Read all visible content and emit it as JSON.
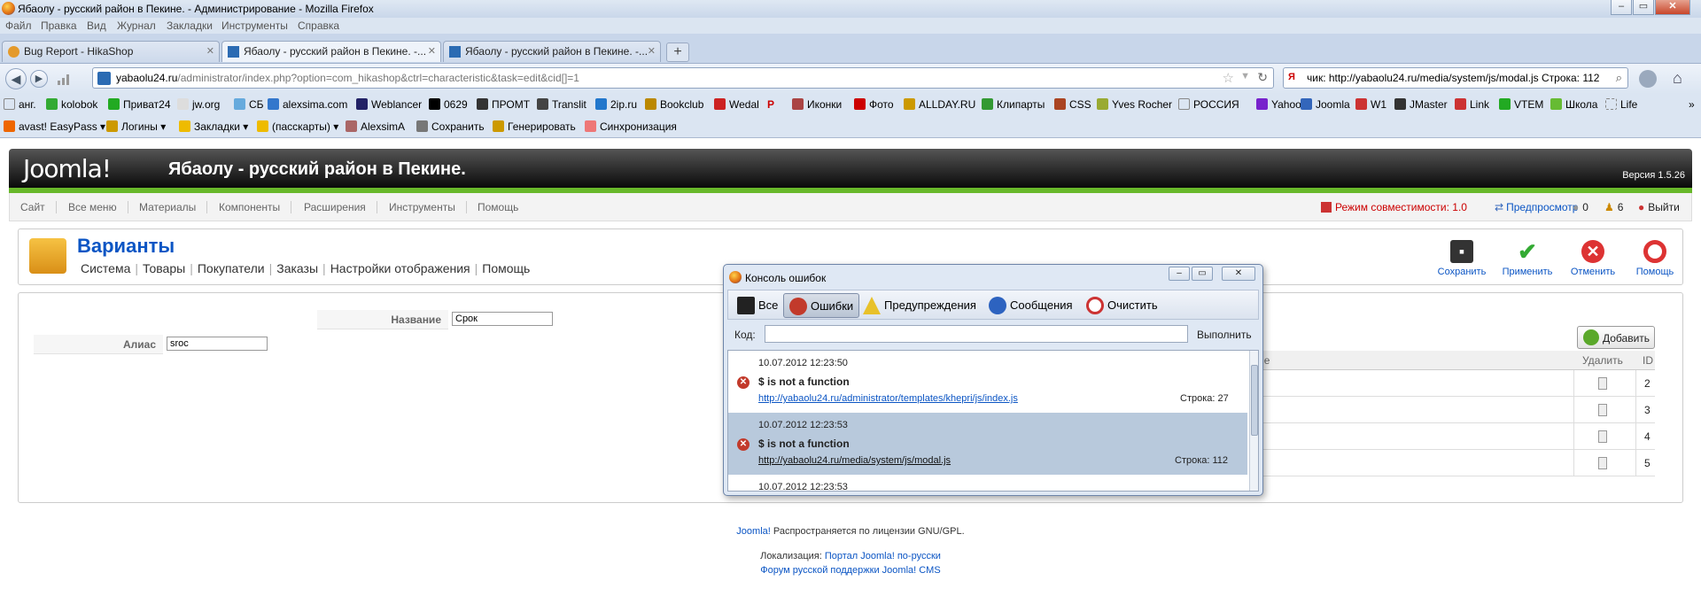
{
  "window": {
    "title": "Ябаолу - русский район в Пекине. - Администрирование - Mozilla Firefox"
  },
  "menu": [
    "Файл",
    "Правка",
    "Вид",
    "Журнал",
    "Закладки",
    "Инструменты",
    "Справка"
  ],
  "tabs": [
    {
      "label": "Bug Report - HikaShop"
    },
    {
      "label": "Ябаолу - русский район в Пекине. -..."
    },
    {
      "label": "Ябаолу - русский район в Пекине. -..."
    }
  ],
  "nav": {
    "url_domain": "yabaolu24.ru",
    "url_path": "/administrator/index.php?option=com_hikashop&ctrl=characteristic&task=edit&cid[]=1",
    "search_value": "чик: http://yabaolu24.ru/media/system/js/modal.js Строка: 112"
  },
  "bookmarks": [
    "анг.",
    "kolobok",
    "Приват24",
    "jw.org",
    "СБ",
    "alexsima.com",
    "Weblancer",
    "0629",
    "ПРОМТ",
    "Translit",
    "2ip.ru",
    "Bookclub",
    "Wedal",
    "Р",
    "Иконки",
    "Фото",
    "ALLDAY.RU",
    "Клипарты",
    "CSS",
    "Yves Rocher",
    "РОССИЯ",
    "Yahoo!",
    "Joomla",
    "W1",
    "JMaster",
    "Link",
    "VTEM",
    "Школа",
    "Life"
  ],
  "addons": [
    "avast! EasyPass",
    "Логины",
    "Закладки",
    "(пасскарты)",
    "AlexsimA",
    "Сохранить",
    "Генерировать",
    "Синхронизация"
  ],
  "joomla": {
    "logo": "Joomla!",
    "site_name": "Ябаолу - русский район в Пекине.",
    "version": "Версия 1.5.26",
    "menu": [
      "Сайт",
      "Все меню",
      "Материалы",
      "Компоненты",
      "Расширения",
      "Инструменты",
      "Помощь"
    ],
    "compat": "Режим совместимости: 1.0",
    "preview": "Предпросмотр",
    "msg_count": "0",
    "users_count": "6",
    "logout": "Выйти"
  },
  "page": {
    "title": "Варианты",
    "submenu": [
      "Система",
      "Товары",
      "Покупатели",
      "Заказы",
      "Настройки отображения",
      "Помощь"
    ],
    "toolbar": [
      "Сохранить",
      "Применить",
      "Отменить",
      "Помощь"
    ],
    "form": {
      "name_label": "Название",
      "name_value": "Срок",
      "alias_label": "Алиас",
      "alias_value": "sroc"
    },
    "add_button": "Добавить",
    "table": {
      "col_value": "ие",
      "col_delete": "Удалить",
      "col_id": "ID",
      "ids": [
        "2",
        "3",
        "4",
        "5"
      ]
    }
  },
  "footer": {
    "line1_link": "Joomla!",
    "line1_text": "Распространяется по лицензии GNU/GPL.",
    "line2_text": "Локализация:",
    "line2_link": "Портал Joomla! по-русски",
    "line3_link": "Форум русской поддержки Joomla! CMS"
  },
  "console": {
    "title": "Консоль ошибок",
    "tools": [
      "Все",
      "Ошибки",
      "Предупреждения",
      "Сообщения",
      "Очистить"
    ],
    "code_label": "Код:",
    "run_label": "Выполнить",
    "entries": [
      {
        "time": "10.07.2012 12:23:50",
        "message": "$ is not a function",
        "source": "http://yabaolu24.ru/administrator/templates/khepri/js/index.js",
        "line": "Строка:   27"
      },
      {
        "time": "10.07.2012 12:23:53",
        "message": "$ is not a function",
        "source": "http://yabaolu24.ru/media/system/js/modal.js",
        "line": "Строка:   112"
      },
      {
        "time": "10.07.2012 12:23:53"
      }
    ]
  }
}
